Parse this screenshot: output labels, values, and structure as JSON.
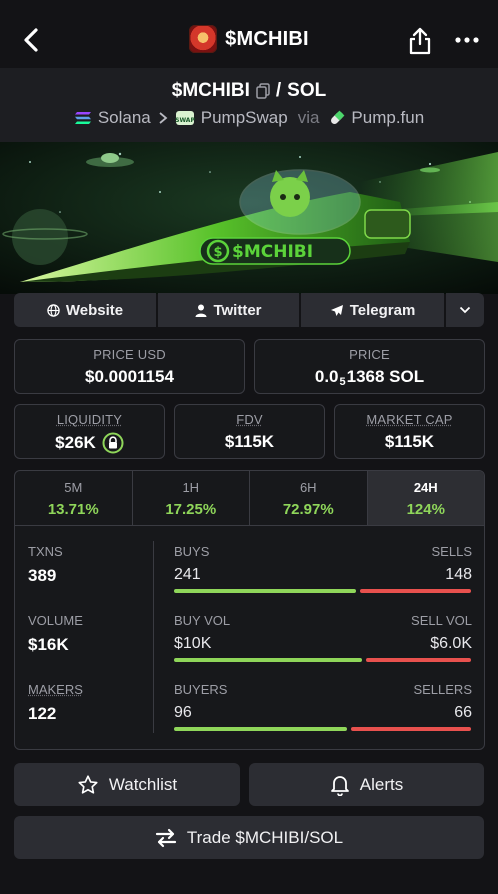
{
  "header": {
    "title": "$MCHIBI"
  },
  "pair": {
    "base": "$MCHIBI",
    "separator": "/",
    "quote": "SOL"
  },
  "route": {
    "chain": "Solana",
    "dex": "PumpSwap",
    "via": "via",
    "launchpad": "Pump.fun"
  },
  "banner": {
    "text": "$MCHIBI",
    "colors": {
      "bg": "#0b1a10",
      "accent": "#58e23a"
    }
  },
  "links": {
    "website": "Website",
    "twitter": "Twitter",
    "telegram": "Telegram"
  },
  "price": {
    "usd_label": "PRICE USD",
    "usd_value": "$0.0001154",
    "native_label": "PRICE",
    "native_prefix": "0.0",
    "native_subscript": "5",
    "native_rest": "1368 SOL"
  },
  "metrics": {
    "liquidity_label": "LIQUIDITY",
    "liquidity_value": "$26K",
    "fdv_label": "FDV",
    "fdv_value": "$115K",
    "mcap_label": "MARKET CAP",
    "mcap_value": "$115K"
  },
  "timeframes": [
    {
      "label": "5M",
      "value": "13.71%"
    },
    {
      "label": "1H",
      "value": "17.25%"
    },
    {
      "label": "6H",
      "value": "72.97%"
    },
    {
      "label": "24H",
      "value": "124%"
    }
  ],
  "stats": {
    "txns_label": "TXNS",
    "txns_value": "389",
    "volume_label": "VOLUME",
    "volume_value": "$16K",
    "makers_label": "MAKERS",
    "makers_value": "122",
    "buys_label": "BUYS",
    "buys_value": "241",
    "sells_label": "SELLS",
    "sells_value": "148",
    "buyvol_label": "BUY VOL",
    "buyvol_value": "$10K",
    "sellvol_label": "SELL VOL",
    "sellvol_value": "$6.0K",
    "buyers_label": "BUYERS",
    "buyers_value": "96",
    "sellers_label": "SELLERS",
    "sellers_value": "66",
    "buys_ratio": 0.62,
    "buyvol_ratio": 0.64,
    "buyers_ratio": 0.59
  },
  "actions": {
    "watchlist": "Watchlist",
    "alerts": "Alerts",
    "trade": "Trade $MCHIBI/SOL"
  },
  "colors": {
    "green": "#8fd65a",
    "red": "#e8514e",
    "card": "#2c2d33"
  }
}
